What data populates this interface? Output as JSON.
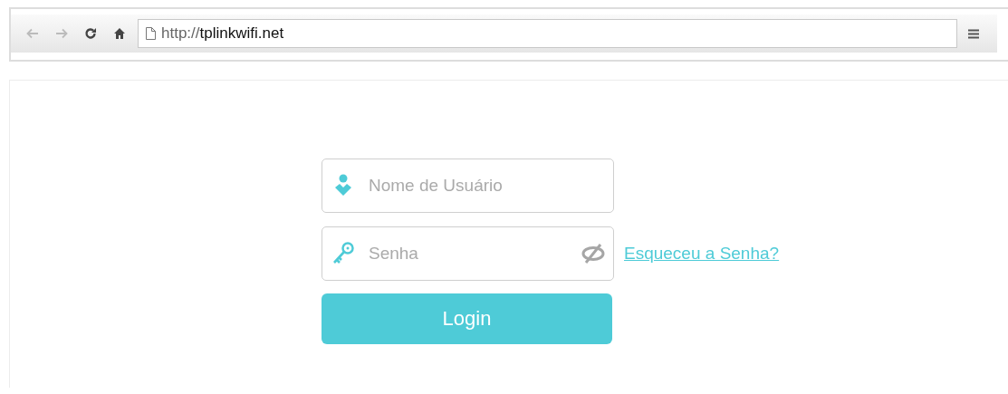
{
  "browser": {
    "back": {
      "disabled": true
    },
    "forward": {
      "disabled": true
    },
    "url_scheme": "http://",
    "url_host": "tplinkwifi.net"
  },
  "login": {
    "username": {
      "placeholder": "Nome de Usuário"
    },
    "password": {
      "placeholder": "Senha"
    },
    "forgot_link": "Esqueceu a Senha?",
    "submit": "Login"
  }
}
